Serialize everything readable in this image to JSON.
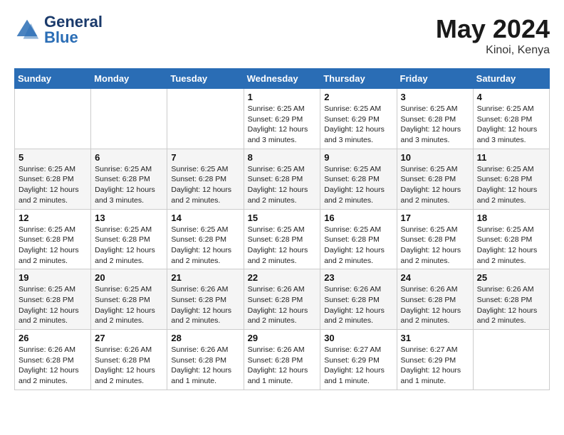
{
  "header": {
    "logo_text_general": "General",
    "logo_text_blue": "Blue",
    "month_year": "May 2024",
    "location": "Kinoi, Kenya"
  },
  "weekdays": [
    "Sunday",
    "Monday",
    "Tuesday",
    "Wednesday",
    "Thursday",
    "Friday",
    "Saturday"
  ],
  "weeks": [
    [
      {
        "day": "",
        "info": ""
      },
      {
        "day": "",
        "info": ""
      },
      {
        "day": "",
        "info": ""
      },
      {
        "day": "1",
        "info": "Sunrise: 6:25 AM\nSunset: 6:29 PM\nDaylight: 12 hours\nand 3 minutes."
      },
      {
        "day": "2",
        "info": "Sunrise: 6:25 AM\nSunset: 6:29 PM\nDaylight: 12 hours\nand 3 minutes."
      },
      {
        "day": "3",
        "info": "Sunrise: 6:25 AM\nSunset: 6:28 PM\nDaylight: 12 hours\nand 3 minutes."
      },
      {
        "day": "4",
        "info": "Sunrise: 6:25 AM\nSunset: 6:28 PM\nDaylight: 12 hours\nand 3 minutes."
      }
    ],
    [
      {
        "day": "5",
        "info": "Sunrise: 6:25 AM\nSunset: 6:28 PM\nDaylight: 12 hours\nand 2 minutes."
      },
      {
        "day": "6",
        "info": "Sunrise: 6:25 AM\nSunset: 6:28 PM\nDaylight: 12 hours\nand 3 minutes."
      },
      {
        "day": "7",
        "info": "Sunrise: 6:25 AM\nSunset: 6:28 PM\nDaylight: 12 hours\nand 2 minutes."
      },
      {
        "day": "8",
        "info": "Sunrise: 6:25 AM\nSunset: 6:28 PM\nDaylight: 12 hours\nand 2 minutes."
      },
      {
        "day": "9",
        "info": "Sunrise: 6:25 AM\nSunset: 6:28 PM\nDaylight: 12 hours\nand 2 minutes."
      },
      {
        "day": "10",
        "info": "Sunrise: 6:25 AM\nSunset: 6:28 PM\nDaylight: 12 hours\nand 2 minutes."
      },
      {
        "day": "11",
        "info": "Sunrise: 6:25 AM\nSunset: 6:28 PM\nDaylight: 12 hours\nand 2 minutes."
      }
    ],
    [
      {
        "day": "12",
        "info": "Sunrise: 6:25 AM\nSunset: 6:28 PM\nDaylight: 12 hours\nand 2 minutes."
      },
      {
        "day": "13",
        "info": "Sunrise: 6:25 AM\nSunset: 6:28 PM\nDaylight: 12 hours\nand 2 minutes."
      },
      {
        "day": "14",
        "info": "Sunrise: 6:25 AM\nSunset: 6:28 PM\nDaylight: 12 hours\nand 2 minutes."
      },
      {
        "day": "15",
        "info": "Sunrise: 6:25 AM\nSunset: 6:28 PM\nDaylight: 12 hours\nand 2 minutes."
      },
      {
        "day": "16",
        "info": "Sunrise: 6:25 AM\nSunset: 6:28 PM\nDaylight: 12 hours\nand 2 minutes."
      },
      {
        "day": "17",
        "info": "Sunrise: 6:25 AM\nSunset: 6:28 PM\nDaylight: 12 hours\nand 2 minutes."
      },
      {
        "day": "18",
        "info": "Sunrise: 6:25 AM\nSunset: 6:28 PM\nDaylight: 12 hours\nand 2 minutes."
      }
    ],
    [
      {
        "day": "19",
        "info": "Sunrise: 6:25 AM\nSunset: 6:28 PM\nDaylight: 12 hours\nand 2 minutes."
      },
      {
        "day": "20",
        "info": "Sunrise: 6:25 AM\nSunset: 6:28 PM\nDaylight: 12 hours\nand 2 minutes."
      },
      {
        "day": "21",
        "info": "Sunrise: 6:26 AM\nSunset: 6:28 PM\nDaylight: 12 hours\nand 2 minutes."
      },
      {
        "day": "22",
        "info": "Sunrise: 6:26 AM\nSunset: 6:28 PM\nDaylight: 12 hours\nand 2 minutes."
      },
      {
        "day": "23",
        "info": "Sunrise: 6:26 AM\nSunset: 6:28 PM\nDaylight: 12 hours\nand 2 minutes."
      },
      {
        "day": "24",
        "info": "Sunrise: 6:26 AM\nSunset: 6:28 PM\nDaylight: 12 hours\nand 2 minutes."
      },
      {
        "day": "25",
        "info": "Sunrise: 6:26 AM\nSunset: 6:28 PM\nDaylight: 12 hours\nand 2 minutes."
      }
    ],
    [
      {
        "day": "26",
        "info": "Sunrise: 6:26 AM\nSunset: 6:28 PM\nDaylight: 12 hours\nand 2 minutes."
      },
      {
        "day": "27",
        "info": "Sunrise: 6:26 AM\nSunset: 6:28 PM\nDaylight: 12 hours\nand 2 minutes."
      },
      {
        "day": "28",
        "info": "Sunrise: 6:26 AM\nSunset: 6:28 PM\nDaylight: 12 hours\nand 1 minute."
      },
      {
        "day": "29",
        "info": "Sunrise: 6:26 AM\nSunset: 6:28 PM\nDaylight: 12 hours\nand 1 minute."
      },
      {
        "day": "30",
        "info": "Sunrise: 6:27 AM\nSunset: 6:29 PM\nDaylight: 12 hours\nand 1 minute."
      },
      {
        "day": "31",
        "info": "Sunrise: 6:27 AM\nSunset: 6:29 PM\nDaylight: 12 hours\nand 1 minute."
      },
      {
        "day": "",
        "info": ""
      }
    ]
  ]
}
